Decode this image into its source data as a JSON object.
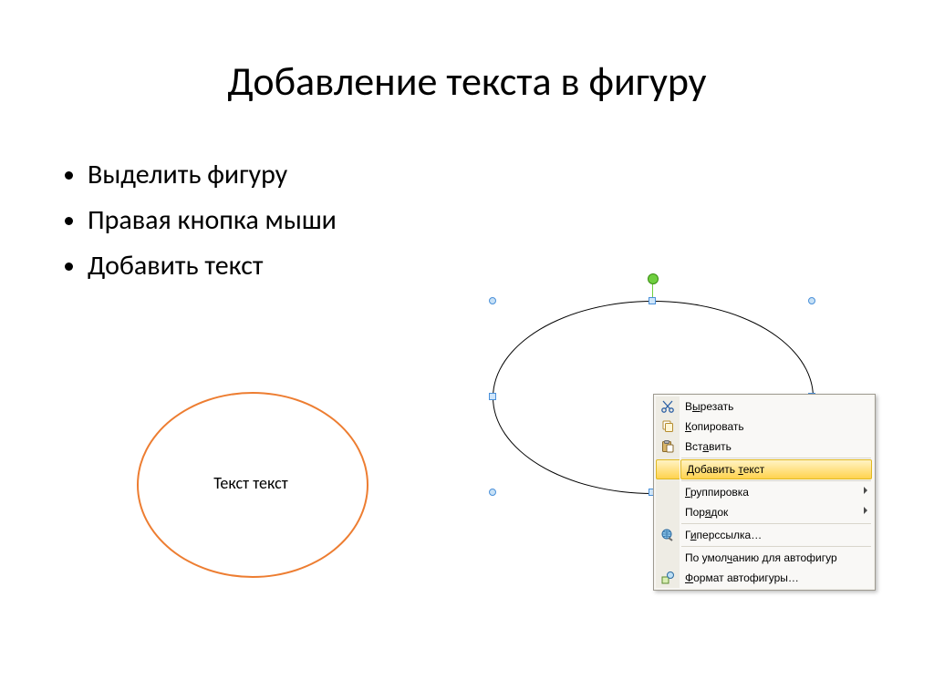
{
  "title": "Добавление текста в фигуру",
  "bullets": [
    "Выделить фигуру",
    "Правая кнопка мыши",
    "Добавить текст"
  ],
  "orange_ellipse_text": "Текст текст",
  "context_menu": {
    "items": [
      {
        "id": "cut",
        "icon": "scissors-icon",
        "pre": "В",
        "u": "ы",
        "post": "резать",
        "arrow": false
      },
      {
        "id": "copy",
        "icon": "copy-icon",
        "pre": "",
        "u": "К",
        "post": "опировать",
        "arrow": false
      },
      {
        "id": "paste",
        "icon": "paste-icon",
        "pre": "Вст",
        "u": "а",
        "post": "вить",
        "arrow": false
      },
      {
        "sep": true
      },
      {
        "id": "add-text",
        "icon": null,
        "pre": "Добавить ",
        "u": "т",
        "post": "екст",
        "arrow": false,
        "highlight": true
      },
      {
        "sep": true
      },
      {
        "id": "group",
        "icon": null,
        "pre": "",
        "u": "Г",
        "post": "руппировка",
        "arrow": true
      },
      {
        "id": "order",
        "icon": null,
        "pre": "Пор",
        "u": "я",
        "post": "док",
        "arrow": true
      },
      {
        "sep": true
      },
      {
        "id": "hyperlink",
        "icon": "globe-link-icon",
        "pre": "Г",
        "u": "и",
        "post": "перссылка…",
        "arrow": false
      },
      {
        "sep": true
      },
      {
        "id": "default-autoshape",
        "icon": null,
        "pre": "По умол",
        "u": "ч",
        "post": "анию для автофигур",
        "arrow": false
      },
      {
        "id": "format-autoshape",
        "icon": "format-shape-icon",
        "pre": "",
        "u": "Ф",
        "post": "ормат автофигуры…",
        "arrow": false
      }
    ]
  }
}
